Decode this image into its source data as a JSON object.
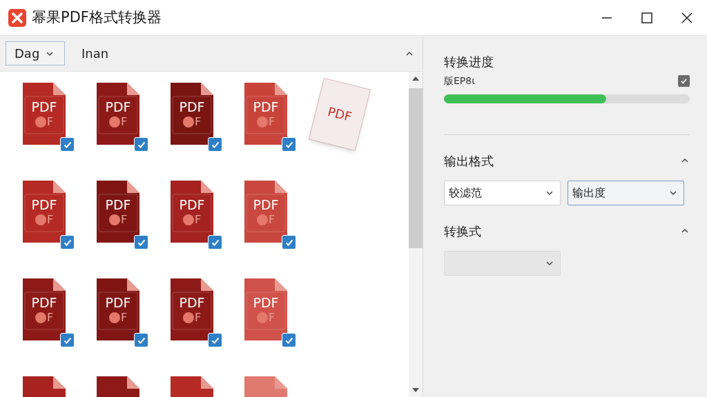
{
  "window": {
    "title": "幂果PDF格式转换器"
  },
  "toolbar": {
    "dropdown": "Dag",
    "label": "Inan"
  },
  "files": [
    [
      {
        "kind": "file",
        "color": "#b52a24",
        "label": "PDF",
        "mark": "F",
        "checked": true
      },
      {
        "kind": "file",
        "color": "#8e1a17",
        "label": "PDF",
        "mark": "F",
        "checked": true
      },
      {
        "kind": "file",
        "color": "#7a1512",
        "label": "PDF",
        "mark": "F",
        "checked": true
      },
      {
        "kind": "file",
        "color": "#c8443b",
        "label": "PDF",
        "mark": "F",
        "checked": true
      },
      {
        "kind": "loose",
        "color": "#f4ecec",
        "label": "PDF"
      }
    ],
    [
      {
        "kind": "file",
        "color": "#b52a24",
        "label": "PDF",
        "mark": "F",
        "checked": true
      },
      {
        "kind": "file",
        "color": "#7f1614",
        "label": "PDF",
        "mark": "F",
        "checked": true
      },
      {
        "kind": "file",
        "color": "#a52220",
        "label": "PDF",
        "mark": "F",
        "checked": true
      },
      {
        "kind": "file",
        "color": "#c9473e",
        "label": "PDF",
        "mark": "F",
        "checked": true
      }
    ],
    [
      {
        "kind": "file",
        "color": "#8e1a17",
        "label": "PDF",
        "mark": "F",
        "checked": true
      },
      {
        "kind": "file",
        "color": "#7f1614",
        "label": "PDF",
        "mark": "F",
        "checked": true
      },
      {
        "kind": "file",
        "color": "#8e1a17",
        "label": "PDF",
        "mark": "F",
        "checked": true
      },
      {
        "kind": "file",
        "color": "#d0524a",
        "label": "PDF",
        "mark": "F",
        "checked": true
      }
    ],
    [
      {
        "kind": "partial",
        "color": "#a82320"
      },
      {
        "kind": "partial",
        "color": "#8e1a17"
      },
      {
        "kind": "partial",
        "color": "#b52a24"
      },
      {
        "kind": "partial",
        "color": "#e07a70"
      }
    ]
  ],
  "progress": {
    "title": "转换进度",
    "subtitle": "版EP8ι",
    "checked": true,
    "level": 0.66
  },
  "output_format": {
    "title": "输出格式",
    "expanded": true,
    "selects": [
      {
        "value": "较滤范",
        "focused": false
      },
      {
        "value": "输出度",
        "focused": true
      }
    ]
  },
  "conversion": {
    "title": "转换式",
    "expanded": true,
    "selects": [
      {
        "disabled": true
      }
    ]
  }
}
